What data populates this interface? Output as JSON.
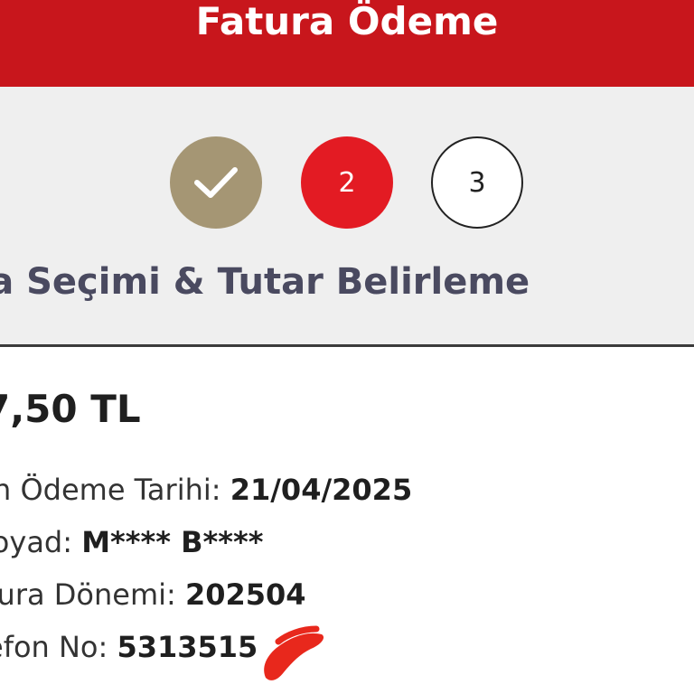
{
  "header": {
    "title": "Fatura Ödeme"
  },
  "stepper": {
    "steps": [
      {
        "label": "",
        "state": "completed",
        "icon": "check-icon"
      },
      {
        "label": "2",
        "state": "active"
      },
      {
        "label": "3",
        "state": "pending"
      }
    ],
    "current_step_title": "ura Seçimi & Tutar Belirleme"
  },
  "bill": {
    "amount": "7,50 TL",
    "details": [
      {
        "label": "n Ödeme Tarihi: ",
        "value": "21/04/2025"
      },
      {
        "label": "d Soyad: ",
        "value": "M**** B****"
      },
      {
        "label": "tura Dönemi: ",
        "value": "202504"
      },
      {
        "label": "efon No: ",
        "value": "5313515"
      }
    ]
  },
  "colors": {
    "header_red": "#c8161c",
    "completed_step": "#a59674",
    "active_step": "#e31b23",
    "redaction_mark": "#e8281c"
  }
}
